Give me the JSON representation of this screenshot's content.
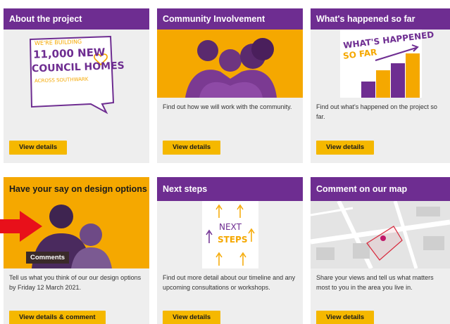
{
  "colors": {
    "purple": "#6e2d91",
    "orange": "#f5a800",
    "button": "#f5b800",
    "arrow": "#e8101a"
  },
  "cards": [
    {
      "title": "About the project",
      "image_text": {
        "line1": "WE'RE BUILDING",
        "line2": "11,000 NEW",
        "line3": "COUNCIL HOMES",
        "line4": "ACROSS SOUTHWARK"
      },
      "description": "",
      "button": "View details"
    },
    {
      "title": "Community Involvement",
      "description": "Find out how we will work with the community.",
      "button": "View details"
    },
    {
      "title": "What's happened so far",
      "image_text": {
        "line1": "WHAT'S HAPPENED",
        "line2": "SO FAR"
      },
      "description": "Find out what's happened on the project so far.",
      "button": "View details"
    },
    {
      "title": "Have your say on design options",
      "image_label": "Comments",
      "description": "Tell us what you think of our our design options by Friday 12 March 2021.",
      "button": "View details & comment"
    },
    {
      "title": "Next steps",
      "image_text": {
        "line1": "NEXT",
        "line2": "STEPS"
      },
      "description": "Find out more detail about our timeline and any upcoming consultations or workshops.",
      "button": "View details"
    },
    {
      "title": "Comment on our map",
      "description": "Share your views and tell us what matters most to you in the area you live in.",
      "button": "View details"
    }
  ]
}
